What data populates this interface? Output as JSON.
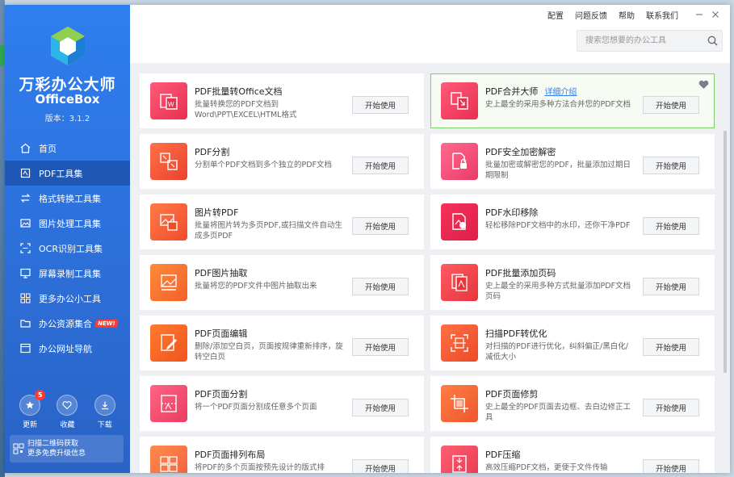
{
  "app": {
    "name_cn": "万彩办公大师",
    "name_en": "OfficeBox",
    "version": "版本：3.1.2"
  },
  "nav": [
    {
      "label": "首页",
      "icon": "home-icon"
    },
    {
      "label": "PDF工具集",
      "icon": "pdf-icon",
      "active": true
    },
    {
      "label": "格式转换工具集",
      "icon": "convert-icon"
    },
    {
      "label": "图片处理工具集",
      "icon": "image-icon"
    },
    {
      "label": "OCR识别工具集",
      "icon": "ocr-icon"
    },
    {
      "label": "屏幕录制工具集",
      "icon": "screen-record-icon"
    },
    {
      "label": "更多办公小工具",
      "icon": "grid-icon"
    },
    {
      "label": "办公资源集合",
      "icon": "resource-icon",
      "badge": "NEW!"
    },
    {
      "label": "办公网址导航",
      "icon": "browser-icon"
    }
  ],
  "bottom_actions": [
    {
      "label": "更新",
      "icon": "update-icon",
      "count": "5"
    },
    {
      "label": "收藏",
      "icon": "heart-icon"
    },
    {
      "label": "下载",
      "icon": "download-icon"
    }
  ],
  "qr": {
    "line1": "扫描二维码获取",
    "line2": "更多免费升级信息"
  },
  "top_links": [
    "配置",
    "问题反馈",
    "帮助",
    "联系我们"
  ],
  "search": {
    "placeholder": "搜索您想要的办公工具",
    "value": ""
  },
  "tools": [
    {
      "title": "PDF批量转Office文档",
      "desc": "批量转换您的PDF文档到Word\\PPT\\EXCEL\\HTML格式",
      "button": "开始使用",
      "icon": "pdf-to-office-icon"
    },
    {
      "title": "PDF合并大师",
      "desc": "史上最全的采用多种方法合并您的PDF文档",
      "button": "开始使用",
      "icon": "pdf-merge-icon",
      "link": "详细介绍",
      "highlight": true
    },
    {
      "title": "PDF分割",
      "desc": "分割单个PDF文档到多个独立的PDF文档",
      "button": "开始使用",
      "icon": "pdf-split-icon"
    },
    {
      "title": "PDF安全加密解密",
      "desc": "批量加密或解密您的PDF，批量添加过期日期限制",
      "button": "开始使用",
      "icon": "pdf-lock-icon"
    },
    {
      "title": "图片转PDF",
      "desc": "批量将图片转为多页PDF,或扫描文件自动生成多页PDF",
      "button": "开始使用",
      "icon": "image-to-pdf-icon"
    },
    {
      "title": "PDF水印移除",
      "desc": "轻松移除PDF文档中的水印，还你干净PDF",
      "button": "开始使用",
      "icon": "watermark-remove-icon"
    },
    {
      "title": "PDF图片抽取",
      "desc": "批量将您的PDF文件中图片抽取出来",
      "button": "开始使用",
      "icon": "image-extract-icon"
    },
    {
      "title": "PDF批量添加页码",
      "desc": "史上最全的采用多种方式批量添加PDF文档页码",
      "button": "开始使用",
      "icon": "page-number-icon"
    },
    {
      "title": "PDF页面编辑",
      "desc": "删除/添加空白页，页面按规律重新排序，旋转空白页",
      "button": "开始使用",
      "icon": "page-edit-icon"
    },
    {
      "title": "扫描PDF转优化",
      "desc": "对扫描的PDF进行优化，纠斜偏正/黑白化/减低大小",
      "button": "开始使用",
      "icon": "scan-optimize-icon"
    },
    {
      "title": "PDF页面分割",
      "desc": "将一个PDF页面分割成任意多个页面",
      "button": "开始使用",
      "icon": "page-split-icon"
    },
    {
      "title": "PDF页面修剪",
      "desc": "史上最全的PDF页面去边框、去白边修正工具",
      "button": "开始使用",
      "icon": "page-crop-icon"
    },
    {
      "title": "PDF页面排列布局",
      "desc": "将PDF的多个页面按预先设计的版式排",
      "button": "开始使用",
      "icon": "page-layout-icon"
    },
    {
      "title": "PDF压缩",
      "desc": "高效压缩PDF文档，更便于文件传输",
      "button": "开始使用",
      "icon": "pdf-compress-icon"
    }
  ],
  "colors": {
    "sidebar": "#2f7ef0",
    "active_nav": "#1f57b4",
    "tool_gradient_red": "#ef3f5a",
    "tool_gradient_orange": "#f47a3a",
    "highlight_border": "#7ccf6c",
    "link": "#2f7ef0"
  }
}
